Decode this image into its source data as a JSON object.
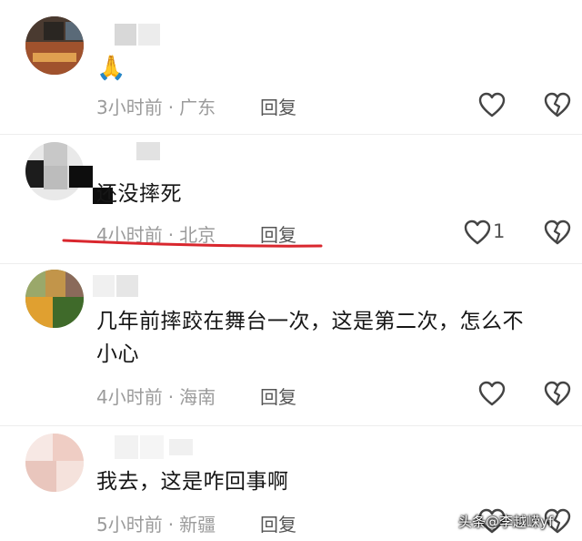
{
  "comments": [
    {
      "text": "🙏",
      "time": "3小时前",
      "location": "广东",
      "reply_label": "回复",
      "like_count": ""
    },
    {
      "text": "还没摔死",
      "time": "4小时前",
      "location": "北京",
      "reply_label": "回复",
      "like_count": "1"
    },
    {
      "text_line1": "几年前摔跤在舞台一次，这是第二次，怎么不",
      "text_line2": "小心",
      "time": "4小时前",
      "location": "海南",
      "reply_label": "回复",
      "like_count": ""
    },
    {
      "text": "我去，这是咋回事啊",
      "time": "5小时前",
      "location": "新疆",
      "reply_label": "回复",
      "like_count": ""
    }
  ],
  "meta_separator": "·",
  "watermark": "头条@李越嵘yf",
  "colors": {
    "highlight_underline": "#d9272e",
    "meta_text": "#9b9b9b"
  },
  "icons": {
    "like": "heart-outline-icon",
    "dislike": "broken-heart-icon"
  }
}
